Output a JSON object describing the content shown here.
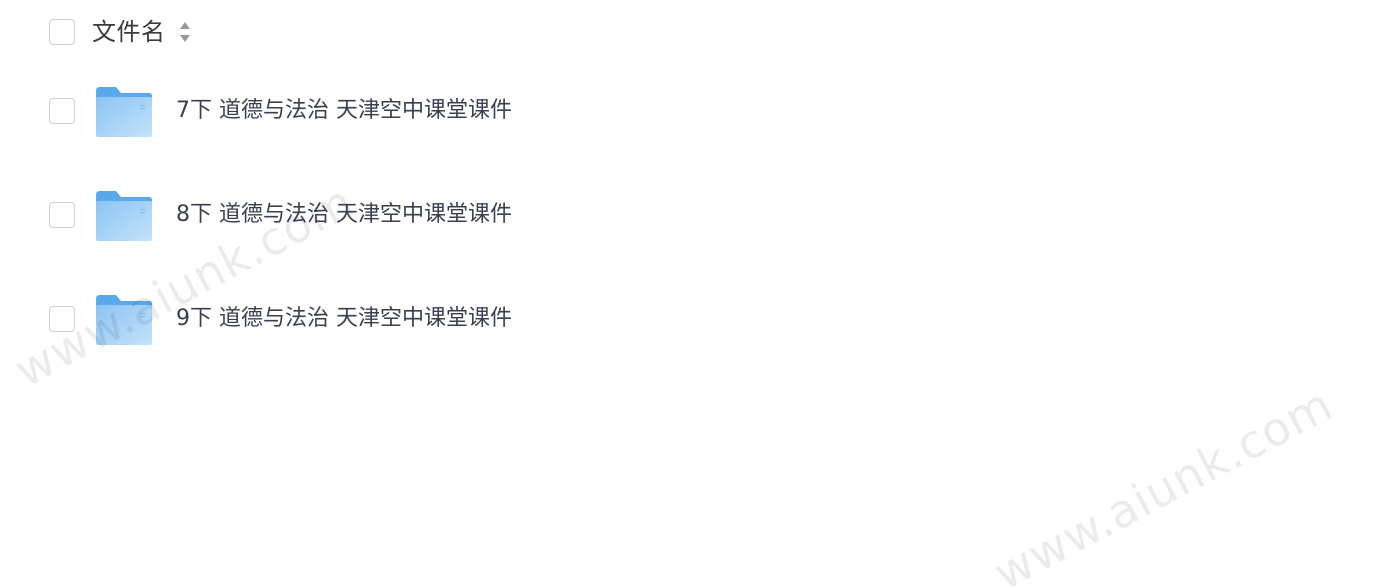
{
  "header": {
    "column_label": "文件名"
  },
  "files": [
    {
      "name": "7下 道德与法治 天津空中课堂课件",
      "type": "folder"
    },
    {
      "name": "8下 道德与法治 天津空中课堂课件",
      "type": "folder"
    },
    {
      "name": "9下 道德与法治 天津空中课堂课件",
      "type": "folder"
    }
  ],
  "watermark": {
    "text": "www.aiunk.com"
  },
  "icons": {
    "folder": "folder-icon",
    "sort": "sort-icon"
  },
  "colors": {
    "folder_light": "#a9d4f7",
    "folder_dark": "#5aa9ec",
    "text": "#3a3f52",
    "checkbox_border": "#cfcfd4"
  }
}
